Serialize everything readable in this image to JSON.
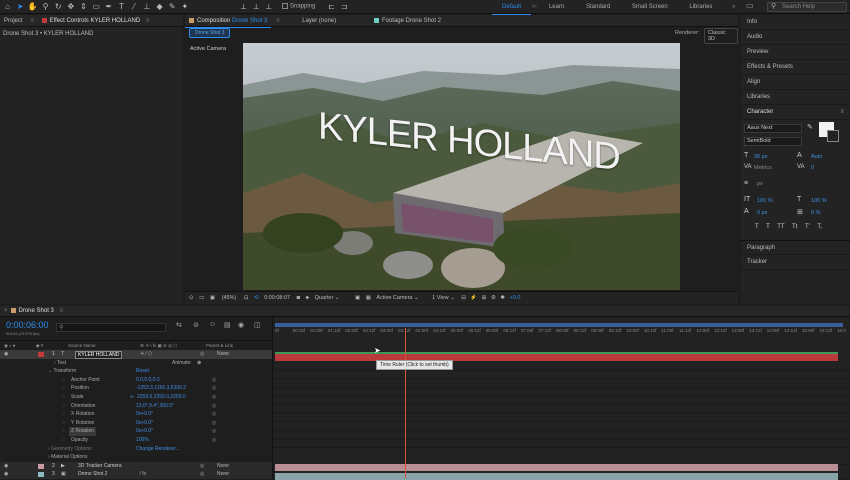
{
  "workspaces": [
    "Default",
    "Learn",
    "Standard",
    "Small Screen",
    "Libraries"
  ],
  "search_placeholder": "Search Help",
  "snapping_label": "Snapping",
  "left_panel": {
    "tab_project": "Project",
    "tab_effect_prefix": "Effect Controls",
    "tab_effect_layer": "KYLER HOLLAND",
    "breadcrumb": "Drone Shot 3 • KYLER HOLLAND"
  },
  "viewer": {
    "tab_comp_prefix": "Composition",
    "tab_comp_name": "Drone Shot 3",
    "tab_layer": "Layer (none)",
    "tab_footage": "Footage Drone Shot 2",
    "comp_button": "Drone Shot 3",
    "renderer_label": "Renderer:",
    "renderer_value": "Classic 3D",
    "active_camera": "Active Camera",
    "title_text": "KYLER HOLLAND",
    "footer": {
      "zoom": "(45%)",
      "timecode": "0:00:08:07",
      "resolution": "Quarter",
      "view": "Active Camera",
      "views": "1 View",
      "exposure": "+0.0"
    }
  },
  "right_panel": {
    "items": [
      "Info",
      "Audio",
      "Preview",
      "Effects & Presets",
      "Align",
      "Libraries"
    ],
    "character_title": "Character",
    "font": "Aaux Next",
    "style": "SemiBold",
    "size": "36 px",
    "leading": "Auto",
    "kerning": "Metrics",
    "tracking": "0",
    "stroke_unit": "px",
    "vert_scale": "100 %",
    "horiz_scale": "100 %",
    "baseline": "0 px",
    "tsume": "0 %",
    "styles": [
      "T",
      "T",
      "TT",
      "Tt",
      "T'",
      "T,"
    ],
    "paragraph": "Paragraph",
    "tracker": "Tracker"
  },
  "timeline": {
    "tab": "Drone Shot 3",
    "timecode": "0:00:06:00",
    "sub_timecode": "00144 (23.976 fps)",
    "col_source": "Source Name",
    "col_parent": "Parent & Link",
    "animate": "Animate:",
    "none": "None",
    "reset": "Reset",
    "ruler": [
      "0f",
      "00:12f",
      "01:00f",
      "01:12f",
      "02:00f",
      "02:12f",
      "03:00f",
      "03:12f",
      "04:00f",
      "04:12f",
      "05:00f",
      "05:12f",
      "06:00f",
      "06:12f",
      "07:00f",
      "07:12f",
      "08:00f",
      "08:12f",
      "09:00f",
      "09:12f",
      "10:00f",
      "10:12f",
      "11:00f",
      "11:12f",
      "12:00f",
      "12:12f",
      "13:00f",
      "13:12f",
      "14:00f",
      "14:12f",
      "15:00f",
      "15:12f",
      "16:0"
    ],
    "tooltip": "Time Ruler (Click to set thumb)",
    "layers": [
      {
        "num": "1",
        "name": "KYLER HOLLAND",
        "color": "#c23a3a"
      },
      {
        "num": "2",
        "name": "3D Tracker Camera",
        "color": "#c99aa0"
      },
      {
        "num": "3",
        "name": "Drone Shot 2",
        "color": "#8cb8c0"
      }
    ],
    "text_label": "Text",
    "transform_label": "Transform",
    "props": [
      {
        "name": "Anchor Point",
        "value": "0.0,0.0,0.0"
      },
      {
        "name": "Position",
        "value": "-1253.3,1156.3,6300.2"
      },
      {
        "name": "Scale",
        "value": "2259.0,2259.0,2259.0"
      },
      {
        "name": "Orientation",
        "value": "13.0°,9.4°,350.5°"
      },
      {
        "name": "X Rotation",
        "value": "0x+0.0°"
      },
      {
        "name": "Y Rotation",
        "value": "0x+0.0°"
      },
      {
        "name": "Z Rotation",
        "value": "0x+0.0°"
      },
      {
        "name": "Opacity",
        "value": "100%"
      }
    ],
    "geometry": "Geometry Options",
    "change_renderer": "Change Renderer...",
    "material": "Material Options"
  },
  "colors": {
    "accent": "#2d8ceb",
    "layer_bar": "#b83a3a",
    "playhead": "#d9533b",
    "work_area": "#3b5f9a"
  }
}
